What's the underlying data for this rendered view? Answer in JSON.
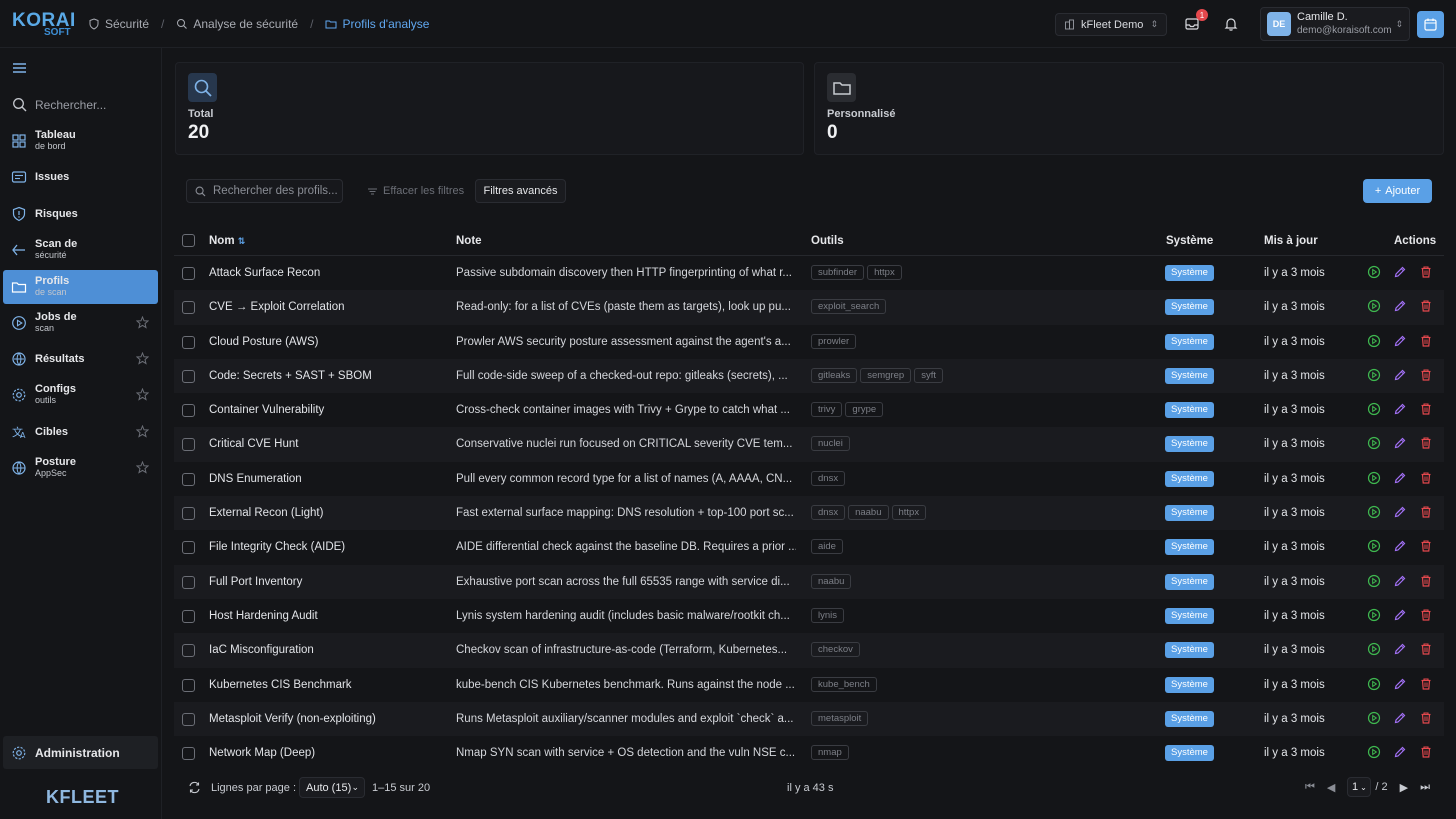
{
  "brand": {
    "logo_top": "KORAI",
    "logo_bottom": "SOFT",
    "footer_logo": "KFLEET"
  },
  "breadcrumb": [
    "Sécurité",
    "Analyse de sécurité",
    "Profils d'analyse"
  ],
  "tenant": "kFleet Demo",
  "notifications_count": "1",
  "user": {
    "initials": "DE",
    "name": "Camille D.",
    "email": "demo@koraisoft.com"
  },
  "sidebar": {
    "search_placeholder": "Rechercher...",
    "items": [
      {
        "l1": "Tableau",
        "l2": "de bord",
        "icon": "grid-icon"
      },
      {
        "l1": "Issues",
        "l2": "",
        "icon": "issues-icon"
      },
      {
        "l1": "Risques",
        "l2": "",
        "icon": "shield-icon"
      },
      {
        "l1": "Scan de",
        "l2": "sécurité",
        "icon": "scan-icon"
      },
      {
        "l1": "Profils",
        "l2": "de scan",
        "icon": "folder-icon"
      },
      {
        "l1": "Jobs de",
        "l2": "scan",
        "icon": "play-circle-icon"
      },
      {
        "l1": "Résultats",
        "l2": "",
        "icon": "results-icon"
      },
      {
        "l1": "Configs",
        "l2": "outils",
        "icon": "gear-icon"
      },
      {
        "l1": "Cibles",
        "l2": "",
        "icon": "target-icon"
      },
      {
        "l1": "Posture",
        "l2": "AppSec",
        "icon": "globe-icon"
      }
    ],
    "admin": "Administration"
  },
  "stats": [
    {
      "label": "Total",
      "value": "20"
    },
    {
      "label": "Personnalisé",
      "value": "0"
    }
  ],
  "toolbar": {
    "search_placeholder": "Rechercher des profils...",
    "clear": "Effacer les filtres",
    "advanced": "Filtres avancés",
    "add": "Ajouter"
  },
  "table": {
    "headers": {
      "name": "Nom",
      "note": "Note",
      "tools": "Outils",
      "system": "Système",
      "updated": "Mis à jour",
      "actions": "Actions"
    },
    "rows": [
      {
        "name": "Attack Surface Recon",
        "note": "Passive subdomain discovery then HTTP fingerprinting of what r...",
        "tools": [
          "subfinder",
          "httpx"
        ],
        "system": "Système",
        "updated": "il y a 3 mois"
      },
      {
        "name": "CVE → Exploit Correlation",
        "note": "Read-only: for a list of CVEs (paste them as targets), look up pu...",
        "tools": [
          "exploit_search"
        ],
        "system": "Système",
        "updated": "il y a 3 mois"
      },
      {
        "name": "Cloud Posture (AWS)",
        "note": "Prowler AWS security posture assessment against the agent's a...",
        "tools": [
          "prowler"
        ],
        "system": "Système",
        "updated": "il y a 3 mois"
      },
      {
        "name": "Code: Secrets + SAST + SBOM",
        "note": "Full code-side sweep of a checked-out repo: gitleaks (secrets), ...",
        "tools": [
          "gitleaks",
          "semgrep",
          "syft"
        ],
        "system": "Système",
        "updated": "il y a 3 mois"
      },
      {
        "name": "Container Vulnerability",
        "note": "Cross-check container images with Trivy + Grype to catch what ...",
        "tools": [
          "trivy",
          "grype"
        ],
        "system": "Système",
        "updated": "il y a 3 mois"
      },
      {
        "name": "Critical CVE Hunt",
        "note": "Conservative nuclei run focused on CRITICAL severity CVE tem...",
        "tools": [
          "nuclei"
        ],
        "system": "Système",
        "updated": "il y a 3 mois"
      },
      {
        "name": "DNS Enumeration",
        "note": "Pull every common record type for a list of names (A, AAAA, CN...",
        "tools": [
          "dnsx"
        ],
        "system": "Système",
        "updated": "il y a 3 mois"
      },
      {
        "name": "External Recon (Light)",
        "note": "Fast external surface mapping: DNS resolution + top-100 port sc...",
        "tools": [
          "dnsx",
          "naabu",
          "httpx"
        ],
        "system": "Système",
        "updated": "il y a 3 mois"
      },
      {
        "name": "File Integrity Check (AIDE)",
        "note": "AIDE differential check against the baseline DB. Requires a prior ...",
        "tools": [
          "aide"
        ],
        "system": "Système",
        "updated": "il y a 3 mois"
      },
      {
        "name": "Full Port Inventory",
        "note": "Exhaustive port scan across the full 65535 range with service di...",
        "tools": [
          "naabu"
        ],
        "system": "Système",
        "updated": "il y a 3 mois"
      },
      {
        "name": "Host Hardening Audit",
        "note": "Lynis system hardening audit (includes basic malware/rootkit ch...",
        "tools": [
          "lynis"
        ],
        "system": "Système",
        "updated": "il y a 3 mois"
      },
      {
        "name": "IaC Misconfiguration",
        "note": "Checkov scan of infrastructure-as-code (Terraform, Kubernetes...",
        "tools": [
          "checkov"
        ],
        "system": "Système",
        "updated": "il y a 3 mois"
      },
      {
        "name": "Kubernetes CIS Benchmark",
        "note": "kube-bench CIS Kubernetes benchmark. Runs against the node ...",
        "tools": [
          "kube_bench"
        ],
        "system": "Système",
        "updated": "il y a 3 mois"
      },
      {
        "name": "Metasploit Verify (non-exploiting)",
        "note": "Runs Metasploit auxiliary/scanner modules and exploit `check` a...",
        "tools": [
          "metasploit"
        ],
        "system": "Système",
        "updated": "il y a 3 mois"
      },
      {
        "name": "Network Map (Deep)",
        "note": "Nmap SYN scan with service + OS detection and the vuln NSE c...",
        "tools": [
          "nmap"
        ],
        "system": "Système",
        "updated": "il y a 3 mois"
      }
    ]
  },
  "footer": {
    "rows_label": "Lignes par page :",
    "rows_value": "Auto (15)",
    "range": "1–15 sur 20",
    "refreshed": "il y a 43 s",
    "page": "1",
    "total_pages": "/ 2"
  },
  "colors": {
    "accent": "#5aa0e6",
    "run": "#3fb950",
    "edit": "#a371f7",
    "delete": "#e5484d"
  }
}
